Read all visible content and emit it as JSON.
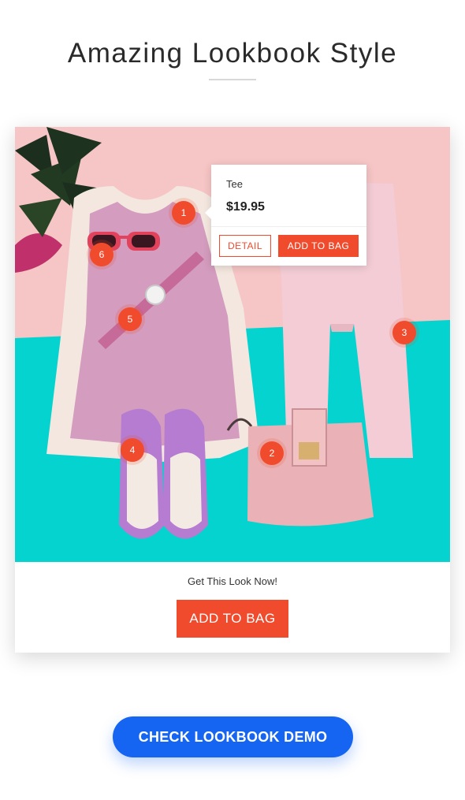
{
  "header": {
    "title": "Amazing Lookbook Style"
  },
  "lookbook": {
    "hotspots": [
      "1",
      "2",
      "3",
      "4",
      "5",
      "6"
    ],
    "popup": {
      "product_name": "Tee",
      "price": "$19.95",
      "detail_label": "DETAIL",
      "add_label": "ADD TO BAG"
    },
    "cta_text": "Get This Look Now!",
    "add_to_bag_label": "ADD TO BAG"
  },
  "demo_button": {
    "label": "CHECK LOOKBOOK DEMO"
  },
  "colors": {
    "accent": "#f04b2d",
    "demo_blue": "#1565f2",
    "pink_bg": "#f6c5c5",
    "teal_bg": "#04d3cf"
  }
}
